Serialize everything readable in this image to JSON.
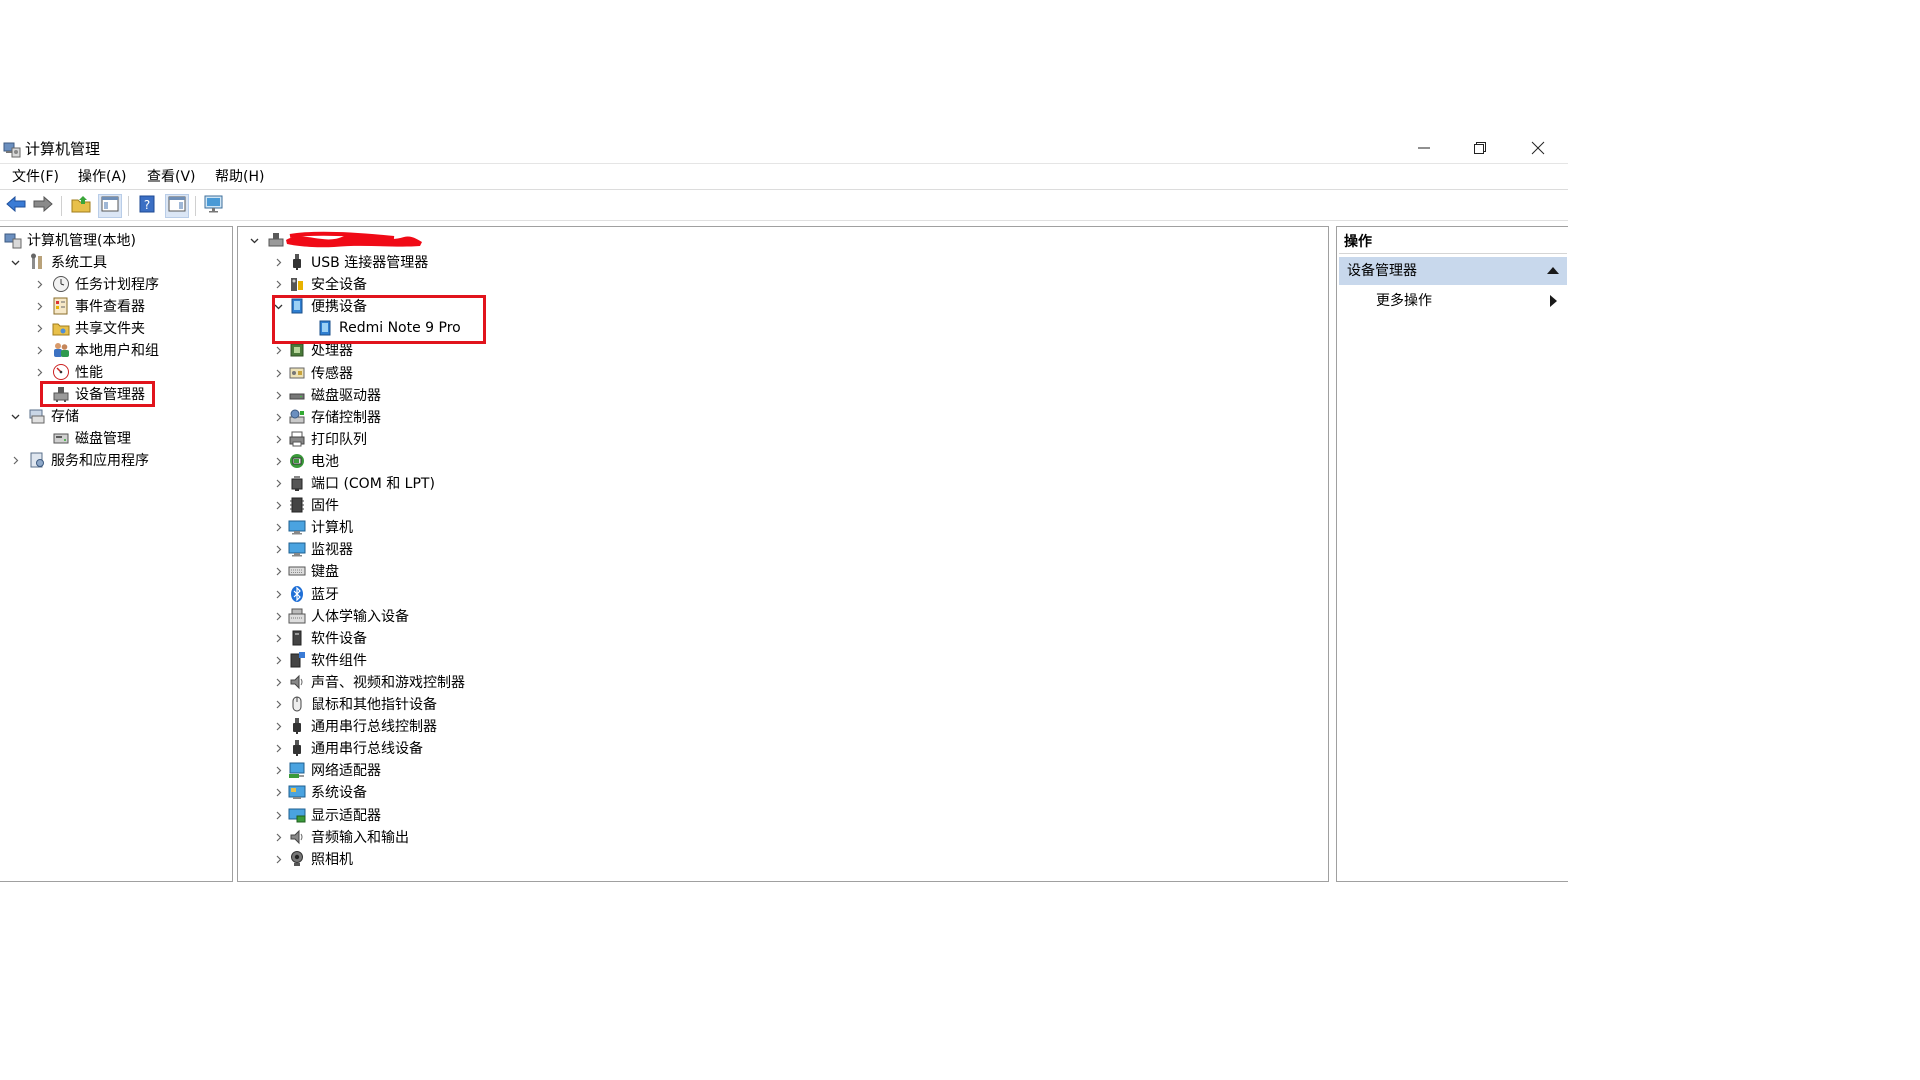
{
  "window": {
    "title": "计算机管理",
    "controls": {
      "minimize": "minimize-icon",
      "restore": "restore-icon",
      "close": "close-icon"
    }
  },
  "menu": [
    "文件(F)",
    "操作(A)",
    "查看(V)",
    "帮助(H)"
  ],
  "toolbar": {
    "buttons": [
      "back-arrow-icon",
      "forward-arrow-icon",
      "up-folder-icon",
      "show-hide-console-tree-icon",
      "help-icon",
      "show-hide-action-pane-icon",
      "monitor-icon"
    ]
  },
  "left_tree": {
    "root": "计算机管理(本地)",
    "system_tools": "系统工具",
    "task_scheduler": "任务计划程序",
    "event_viewer": "事件查看器",
    "shared_folders": "共享文件夹",
    "local_users": "本地用户和组",
    "performance": "性能",
    "device_manager": "设备管理器",
    "storage": "存储",
    "disk_management": "磁盘管理",
    "services_apps": "服务和应用程序"
  },
  "device_tree": {
    "categories": [
      "USB 连接器管理器",
      "安全设备",
      "便携设备",
      "处理器",
      "传感器",
      "磁盘驱动器",
      "存储控制器",
      "打印队列",
      "电池",
      "端口 (COM 和 LPT)",
      "固件",
      "计算机",
      "监视器",
      "键盘",
      "蓝牙",
      "人体学输入设备",
      "软件设备",
      "软件组件",
      "声音、视频和游戏控制器",
      "鼠标和其他指针设备",
      "通用串行总线控制器",
      "通用串行总线设备",
      "网络适配器",
      "系统设备",
      "显示适配器",
      "音频输入和输出",
      "照相机"
    ],
    "expanded_child": "Redmi Note 9 Pro"
  },
  "actions": {
    "header": "操作",
    "group": "设备管理器",
    "more": "更多操作"
  },
  "colors": {
    "highlight_box": "#e1141c",
    "action_group_bg": "#c8d8ec"
  }
}
